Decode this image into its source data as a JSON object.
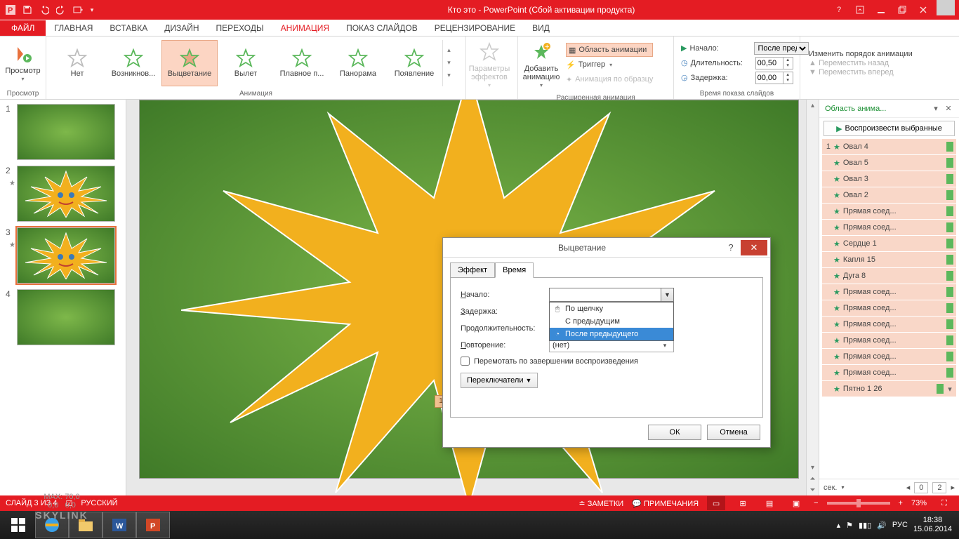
{
  "title": "Кто это -  PowerPoint (Сбой активации продукта)",
  "tabs": {
    "file": "ФАЙЛ",
    "home": "ГЛАВНАЯ",
    "insert": "ВСТАВКА",
    "design": "ДИЗАЙН",
    "transitions": "ПЕРЕХОДЫ",
    "animation": "АНИМАЦИЯ",
    "slideshow": "ПОКАЗ СЛАЙДОВ",
    "review": "РЕЦЕНЗИРОВАНИЕ",
    "view": "ВИД"
  },
  "ribbon": {
    "preview_btn": "Просмотр",
    "preview_grp": "Просмотр",
    "anim": [
      "Нет",
      "Возникнов...",
      "Выцветание",
      "Вылет",
      "Плавное п...",
      "Панорама",
      "Появление"
    ],
    "anim_grp": "Анимация",
    "params": "Параметры эффектов",
    "add": "Добавить анимацию",
    "adv": {
      "pane": "Область анимации",
      "trigger": "Триггер",
      "painter": "Анимация по образцу",
      "grp": "Расширенная анимация"
    },
    "timing": {
      "start": "Начало:",
      "start_val": "После пред...",
      "dur": "Длительность:",
      "dur_val": "00,50",
      "delay": "Задержка:",
      "delay_val": "00,00",
      "grp": "Время показа слайдов"
    },
    "reorder": {
      "hdr": "Изменить порядок анимации",
      "back": "Переместить назад",
      "fwd": "Переместить вперед"
    }
  },
  "thumbs": [
    {
      "n": "1"
    },
    {
      "n": "2"
    },
    {
      "n": "3"
    },
    {
      "n": "4"
    }
  ],
  "anim_pane": {
    "title": "Область анима...",
    "play": "Воспроизвести выбранные",
    "items": [
      {
        "n": "1",
        "name": "Овал 4"
      },
      {
        "n": "",
        "name": "Овал 5"
      },
      {
        "n": "",
        "name": "Овал 3"
      },
      {
        "n": "",
        "name": "Овал 2"
      },
      {
        "n": "",
        "name": "Прямая соед..."
      },
      {
        "n": "",
        "name": "Прямая соед..."
      },
      {
        "n": "",
        "name": "Сердце 1"
      },
      {
        "n": "",
        "name": "Капля 15"
      },
      {
        "n": "",
        "name": "Дуга 8"
      },
      {
        "n": "",
        "name": "Прямая соед..."
      },
      {
        "n": "",
        "name": "Прямая соед..."
      },
      {
        "n": "",
        "name": "Прямая соед..."
      },
      {
        "n": "",
        "name": "Прямая соед..."
      },
      {
        "n": "",
        "name": "Прямая соед..."
      },
      {
        "n": "",
        "name": "Прямая соед..."
      },
      {
        "n": "",
        "name": "Пятно 1 26"
      }
    ],
    "sec": "сек.",
    "pg0": "0",
    "pg2": "2"
  },
  "dialog": {
    "title": "Выцветание",
    "tab_effect": "Эффект",
    "tab_time": "Время",
    "start": "Начало:",
    "delay": "Задержка:",
    "duration": "Продолжительность:",
    "repeat": "Повторение:",
    "repeat_val": "(нет)",
    "rewind": "Перемотать по завершении воспроизведения",
    "toggles": "Переключатели",
    "ok": "ОК",
    "cancel": "Отмена",
    "opts": [
      "По щелчку",
      "С предыдущим",
      "После предыдущего"
    ]
  },
  "status": {
    "slide": "СЛАЙД 3 ИЗ 4",
    "lang": "РУССКИЙ",
    "notes": "ЗАМЕТКИ",
    "comments": "ПРИМЕЧАНИЯ",
    "zoom": "73%"
  },
  "wm": {
    "max": "MAX: 70,0",
    "dl": "0,0",
    "ul": "0,0",
    "brand": "SKYLINK"
  },
  "tray": {
    "kb": "РУС",
    "time": "18:38",
    "date": "15.06.2014"
  },
  "slide_tag": "1"
}
